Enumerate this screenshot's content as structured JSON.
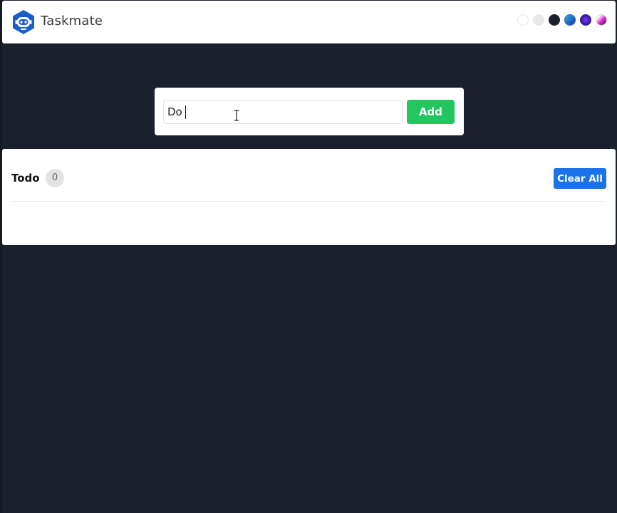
{
  "app": {
    "name": "Taskmate",
    "logo_icon": "robot-icon",
    "brand_color": "#1a5fc8"
  },
  "themes": [
    {
      "name": "light",
      "color": "#ffffff"
    },
    {
      "name": "grey",
      "color": "#e9e9e9"
    },
    {
      "name": "dark",
      "color": "#1a212c"
    },
    {
      "name": "blue-gradient",
      "color": "#2663c4"
    },
    {
      "name": "purple-gradient",
      "color": "#3b1ca0"
    },
    {
      "name": "pink-gradient",
      "color": "#e02bd0"
    }
  ],
  "task_form": {
    "input_value": "Do ",
    "add_label": "Add",
    "add_color": "#22c55e"
  },
  "todo": {
    "title": "Todo",
    "count": "0",
    "clear_label": "Clear All",
    "clear_color": "#1a73e8",
    "items": []
  },
  "page": {
    "background": "#1a212c"
  }
}
